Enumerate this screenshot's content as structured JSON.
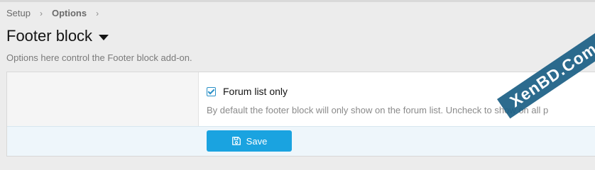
{
  "breadcrumb": {
    "items": [
      "Setup",
      "Options"
    ]
  },
  "page": {
    "title": "Footer block",
    "description": "Options here control the Footer block add-on."
  },
  "option": {
    "label": "Forum list only",
    "checked": true,
    "hint": "By default the footer block will only show on the forum list. Uncheck to show on all p"
  },
  "actions": {
    "save_label": "Save"
  },
  "watermark": {
    "text": "XenBD.Com"
  },
  "colors": {
    "accent": "#1aa3e0",
    "footer_bg": "#eef6fb",
    "checkbox": "#2a90c7"
  }
}
